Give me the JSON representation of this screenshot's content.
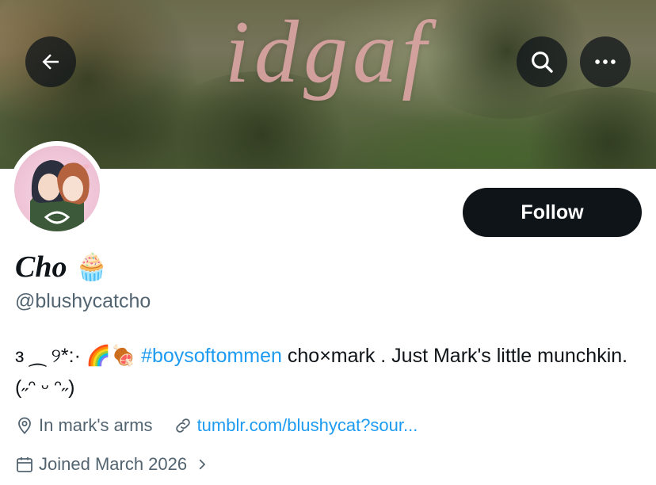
{
  "banner": {
    "text": "idgaf"
  },
  "profile": {
    "display_name": "Cho",
    "name_emoji": "🧁",
    "handle": "@blushycatcho",
    "bio_prefix": "ɜ ⁔ ୨*:· 🌈🍖",
    "bio_hashtag": "#boysoftommen",
    "bio_suffix": " cho×mark . Just Mark's little munchkin. (˶ᵔ ᵕ ᵔ˶)",
    "location": "In mark's arms",
    "website": "tumblr.com/blushycat?sour...",
    "joined": "Joined March 2026"
  },
  "actions": {
    "follow_label": "Follow"
  },
  "icons": {
    "back": "arrow-left-icon",
    "search": "search-icon",
    "more": "more-icon",
    "location": "location-pin-icon",
    "link": "link-icon",
    "calendar": "calendar-icon",
    "chevron": "chevron-right-icon"
  },
  "colors": {
    "link": "#1d9bf0",
    "secondary_text": "#536471",
    "button_bg": "#0f1419"
  }
}
